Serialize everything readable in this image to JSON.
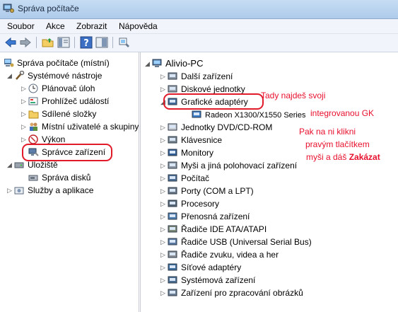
{
  "window": {
    "title": "Správa počítače"
  },
  "menu": [
    "Soubor",
    "Akce",
    "Zobrazit",
    "Nápověda"
  ],
  "toolbar": {
    "icons": [
      "back-arrow-icon",
      "forward-arrow-icon",
      "up-folder-icon",
      "show-hide-tree-icon",
      "help-icon",
      "console-icon",
      "properties-icon"
    ]
  },
  "left_tree": [
    {
      "label": "Správa počítače (místní)",
      "icon": "computer-management-icon",
      "expander": ""
    },
    {
      "label": "Systémové nástroje",
      "icon": "tools-icon",
      "expander": "◢"
    },
    {
      "label": "Plánovač úloh",
      "icon": "clock-icon",
      "expander": "▷"
    },
    {
      "label": "Prohlížeč událostí",
      "icon": "event-viewer-icon",
      "expander": "▷"
    },
    {
      "label": "Sdílené složky",
      "icon": "shared-folder-icon",
      "expander": "▷"
    },
    {
      "label": "Místní uživatelé a skupiny",
      "icon": "users-icon",
      "expander": "▷"
    },
    {
      "label": "Výkon",
      "icon": "performance-icon",
      "expander": "▷"
    },
    {
      "label": "Správce zařízení",
      "icon": "device-manager-icon",
      "expander": ""
    },
    {
      "label": "Úložiště",
      "icon": "storage-icon",
      "expander": "◢"
    },
    {
      "label": "Správa disků",
      "icon": "disk-icon",
      "expander": ""
    },
    {
      "label": "Služby a aplikace",
      "icon": "services-icon",
      "expander": "▷"
    }
  ],
  "device_tree": {
    "root": "Alivio-PC",
    "items": [
      {
        "label": "Další zařízení",
        "icon": "other-devices-icon",
        "expander": "▷"
      },
      {
        "label": "Diskové jednotky",
        "icon": "disk-drive-icon",
        "expander": "▷"
      },
      {
        "label": "Grafické adaptéry",
        "icon": "display-adapter-icon",
        "expander": "◢"
      },
      {
        "label": "Radeon X1300/X1550 Series",
        "icon": "gpu-icon",
        "expander": ""
      },
      {
        "label": "Jednotky DVD/CD-ROM",
        "icon": "dvd-icon",
        "expander": "▷"
      },
      {
        "label": "Klávesnice",
        "icon": "keyboard-icon",
        "expander": "▷"
      },
      {
        "label": "Monitory",
        "icon": "monitor-icon",
        "expander": "▷"
      },
      {
        "label": "Myši a jiná polohovací zařízení",
        "icon": "mouse-icon",
        "expander": "▷"
      },
      {
        "label": "Počítač",
        "icon": "computer-icon",
        "expander": "▷"
      },
      {
        "label": "Porty (COM a LPT)",
        "icon": "port-icon",
        "expander": "▷"
      },
      {
        "label": "Procesory",
        "icon": "processor-icon",
        "expander": "▷"
      },
      {
        "label": "Přenosná zařízení",
        "icon": "portable-device-icon",
        "expander": "▷"
      },
      {
        "label": "Řadiče IDE ATA/ATAPI",
        "icon": "ide-controller-icon",
        "expander": "▷"
      },
      {
        "label": "Řadiče USB (Universal Serial Bus)",
        "icon": "usb-icon",
        "expander": "▷"
      },
      {
        "label": "Řadiče zvuku, videa a her",
        "icon": "sound-icon",
        "expander": "▷"
      },
      {
        "label": "Síťové adaptéry",
        "icon": "network-icon",
        "expander": "▷"
      },
      {
        "label": "Systémová zařízení",
        "icon": "system-devices-icon",
        "expander": "▷"
      },
      {
        "label": "Zařízení pro zpracování obrázků",
        "icon": "imaging-icon",
        "expander": "▷"
      }
    ]
  },
  "annotations": {
    "a1": "Tady najdeš svoji",
    "a2": "integrovanou GK",
    "a3": "Pak na ni klikni",
    "a4": "pravým tlačítkem",
    "a5_prefix": "myši a dáš ",
    "a5_bold": "Zakázat"
  },
  "colors": {
    "annotation": "#e8102d",
    "titlebar": "#b9d1ea",
    "pane_border": "#c7ccd4"
  }
}
